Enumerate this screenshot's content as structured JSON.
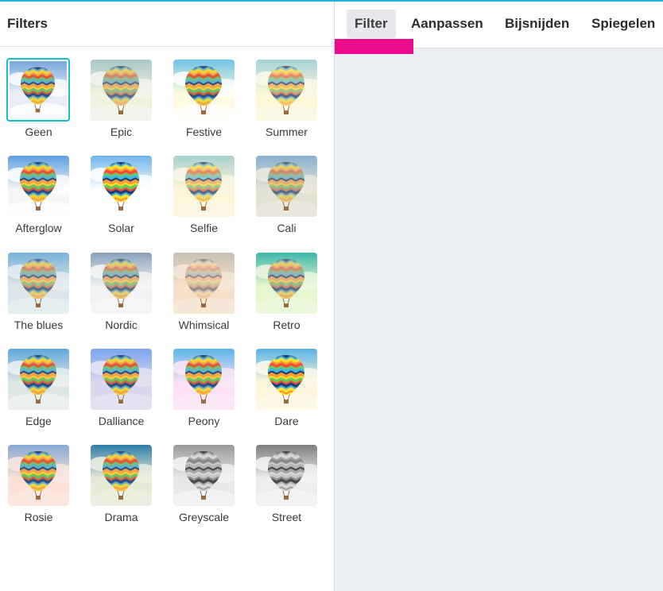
{
  "panel": {
    "title": "Filters"
  },
  "tabs": [
    {
      "label": "Filter",
      "active": true
    },
    {
      "label": "Aanpassen",
      "active": false
    },
    {
      "label": "Bijsnijden",
      "active": false
    },
    {
      "label": "Spiegelen",
      "active": false
    }
  ],
  "colors": {
    "accent_cyan": "#13c1ce",
    "tab_indicator": "#ee0a8c",
    "canvas_bg": "#ebeef2"
  },
  "filters": [
    {
      "label": "Geen",
      "selected": true,
      "sky": "#7aa6de",
      "bottom": "#e9edf5",
      "cloud": "#ffffff",
      "balloon": "full"
    },
    {
      "label": "Epic",
      "selected": false,
      "sky": "#a9c6c9",
      "bottom": "#f0f2e0",
      "cloud": "#f3f5ee",
      "balloon": "muted"
    },
    {
      "label": "Festive",
      "selected": false,
      "sky": "#6fc2e8",
      "bottom": "#fffbe0",
      "cloud": "#ffffff",
      "balloon": "full"
    },
    {
      "label": "Summer",
      "selected": false,
      "sky": "#a6d2d8",
      "bottom": "#fcf8d8",
      "cloud": "#fbf9e8",
      "balloon": "warm"
    },
    {
      "label": "Afterglow",
      "selected": false,
      "sky": "#5e9ee0",
      "bottom": "#f6f6f6",
      "cloud": "#ffffff",
      "balloon": "full"
    },
    {
      "label": "Solar",
      "selected": false,
      "sky": "#6fb3ea",
      "bottom": "#ffffff",
      "cloud": "#ffffff",
      "balloon": "bright"
    },
    {
      "label": "Selfie",
      "selected": false,
      "sky": "#a8d0d0",
      "bottom": "#fff6d8",
      "cloud": "#fbf7e6",
      "balloon": "warm"
    },
    {
      "label": "Cali",
      "selected": false,
      "sky": "#8ab0d2",
      "bottom": "#e2e2d2",
      "cloud": "#eceade",
      "balloon": "muted"
    },
    {
      "label": "The blues",
      "selected": false,
      "sky": "#79b2d6",
      "bottom": "#dde6ea",
      "cloud": "#e9eff2",
      "balloon": "muted"
    },
    {
      "label": "Nordic",
      "selected": false,
      "sky": "#8aa2bc",
      "bottom": "#f2f2f2",
      "cloud": "#f6f6f6",
      "balloon": "muted"
    },
    {
      "label": "Whimsical",
      "selected": false,
      "sky": "#c8c1b6",
      "bottom": "#f8e0c8",
      "cloud": "#f6e8da",
      "balloon": "pale"
    },
    {
      "label": "Retro",
      "selected": false,
      "sky": "#3eb8aa",
      "bottom": "#e6f7cf",
      "cloud": "#eef8de",
      "balloon": "muted"
    },
    {
      "label": "Edge",
      "selected": false,
      "sky": "#5fa8db",
      "bottom": "#dfe7e4",
      "cloud": "#eef2f0",
      "balloon": "full"
    },
    {
      "label": "Dalliance",
      "selected": false,
      "sky": "#7aa4ee",
      "bottom": "#dcd7ee",
      "cloud": "#e7e3f4",
      "balloon": "full"
    },
    {
      "label": "Peony",
      "selected": false,
      "sky": "#5cb4ea",
      "bottom": "#fde2f6",
      "cloud": "#fbe8f6",
      "balloon": "full"
    },
    {
      "label": "Dare",
      "selected": false,
      "sky": "#58b2e6",
      "bottom": "#fff6dc",
      "cloud": "#fffbe8",
      "balloon": "bright"
    },
    {
      "label": "Rosie",
      "selected": false,
      "sky": "#86a8d2",
      "bottom": "#fde0d6",
      "cloud": "#fbe9e2",
      "balloon": "full"
    },
    {
      "label": "Drama",
      "selected": false,
      "sky": "#2f7ea8",
      "bottom": "#e6ebd8",
      "cloud": "#eef0e2",
      "balloon": "full"
    },
    {
      "label": "Greyscale",
      "selected": false,
      "sky": "#9a9a9a",
      "bottom": "#e8e8e8",
      "cloud": "#f4f4f4",
      "balloon": "grey"
    },
    {
      "label": "Street",
      "selected": false,
      "sky": "#7e7e7e",
      "bottom": "#ededed",
      "cloud": "#f4f4f4",
      "balloon": "grey"
    }
  ]
}
